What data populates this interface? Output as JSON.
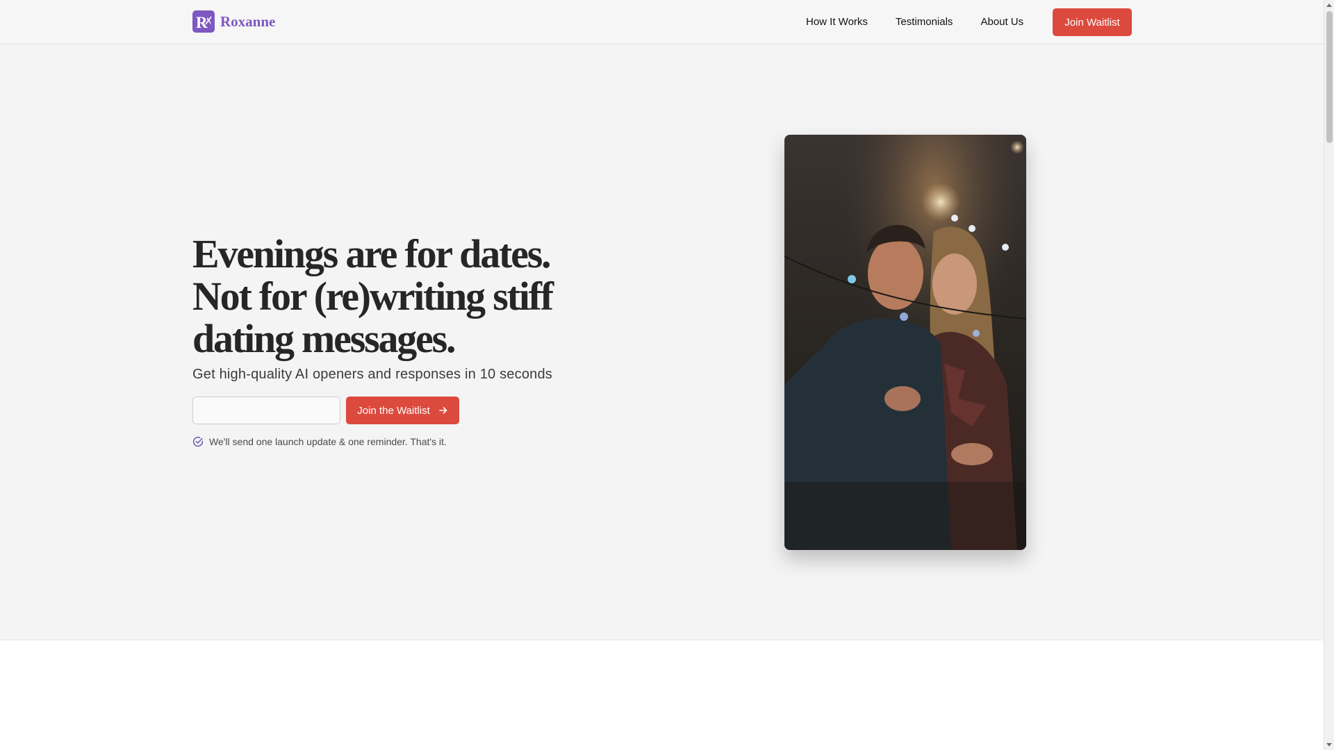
{
  "header": {
    "logo_letter": "R",
    "brand": "Roxanne",
    "brand_color": "#7e57c2",
    "nav": [
      {
        "label": "How It Works"
      },
      {
        "label": "Testimonials"
      },
      {
        "label": "About Us"
      }
    ],
    "cta_label": "Join Waitlist"
  },
  "hero": {
    "headline_lines": [
      "Evenings are for dates.",
      "Not for (re)writing stiff",
      "dating messages."
    ],
    "subhead": "Get high-quality AI openers and responses in 10 seconds",
    "email_value": "",
    "cta_label": "Join the Waitlist",
    "cta_icon": "arrow-right-icon",
    "note": "We'll send one launch update & one reminder. That's it.",
    "note_icon": "check-circle-icon",
    "accent_color": "#dc4a3e"
  }
}
